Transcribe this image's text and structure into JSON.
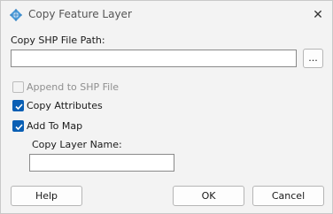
{
  "window": {
    "title": "Copy Feature Layer"
  },
  "shp_path": {
    "label": "Copy SHP File Path:",
    "value": "",
    "browse_label": "..."
  },
  "options": {
    "append": {
      "label": "Append to SHP File",
      "checked": false,
      "enabled": false
    },
    "copy_attributes": {
      "label": "Copy Attributes",
      "checked": true,
      "enabled": true
    },
    "add_to_map": {
      "label": "Add To Map",
      "checked": true,
      "enabled": true
    }
  },
  "layer_name": {
    "label": "Copy Layer Name:",
    "value": ""
  },
  "buttons": {
    "help": "Help",
    "ok": "OK",
    "cancel": "Cancel"
  },
  "colors": {
    "accent": "#0a5fb4",
    "disabled_text": "#8f8f8f"
  },
  "icons": {
    "app": "feature-layer-icon",
    "close": "close-icon",
    "check": "check-icon"
  }
}
